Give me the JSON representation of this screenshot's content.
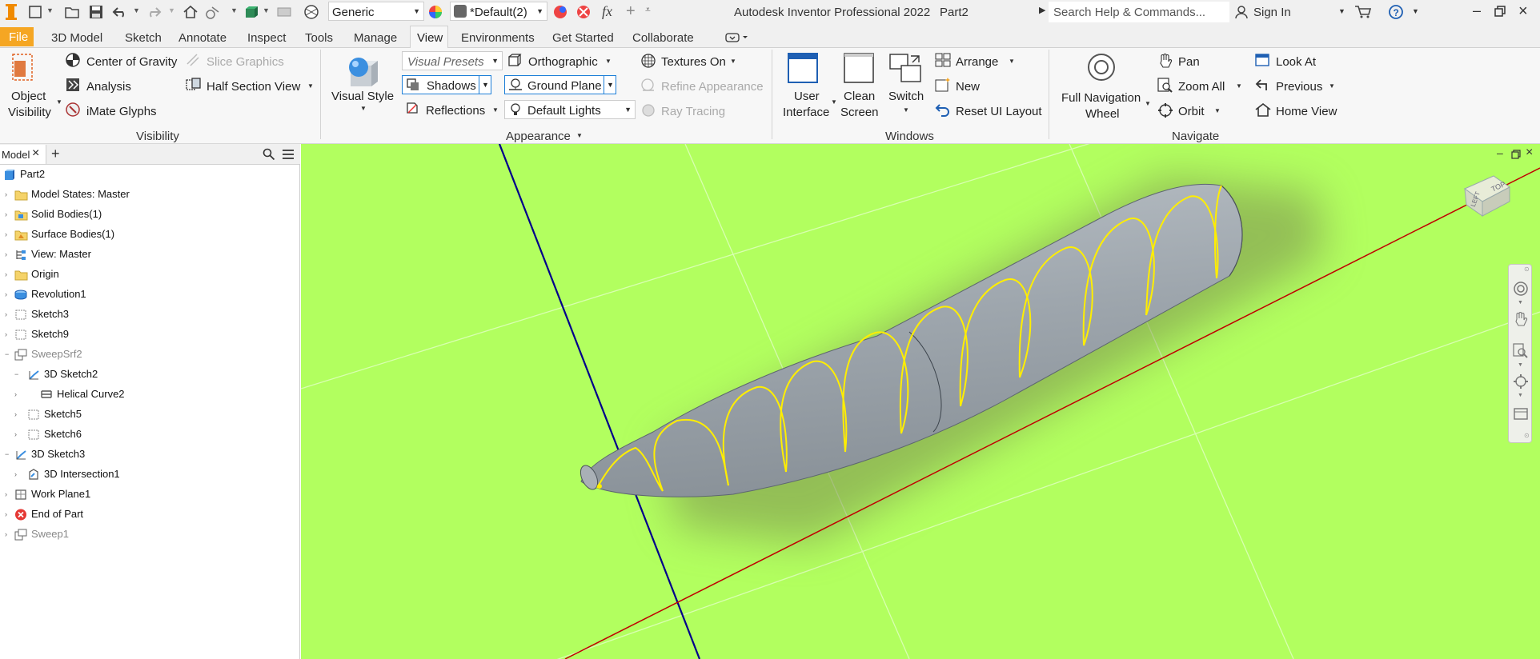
{
  "titlebar": {
    "app_title": "Autodesk Inventor Professional 2022",
    "doc_name": "Part2",
    "material_value": "Generic",
    "appearance_value": "*Default(2)",
    "fx_label": "fx",
    "search_placeholder": "Search Help & Commands...",
    "sign_in": "Sign In"
  },
  "tabs": [
    "File",
    "3D Model",
    "Sketch",
    "Annotate",
    "Inspect",
    "Tools",
    "Manage",
    "View",
    "Environments",
    "Get Started",
    "Collaborate"
  ],
  "active_tab": "View",
  "ribbon": {
    "visibility": {
      "object_visibility_line1": "Object",
      "object_visibility_line2": "Visibility",
      "center_of_gravity": "Center of Gravity",
      "analysis": "Analysis",
      "imate_glyphs": "iMate Glyphs",
      "slice_graphics": "Slice Graphics",
      "half_section_view": "Half Section View",
      "title": "Visibility"
    },
    "appearance": {
      "visual_style": "Visual Style",
      "visual_presets": "Visual Presets",
      "shadows": "Shadows",
      "reflections": "Reflections",
      "orthographic": "Orthographic",
      "ground_plane": "Ground Plane",
      "default_lights": "Default Lights",
      "textures_on": "Textures On",
      "refine_appearance": "Refine Appearance",
      "ray_tracing": "Ray Tracing",
      "title": "Appearance"
    },
    "windows": {
      "user_interface_line1": "User",
      "user_interface_line2": "Interface",
      "clean_screen_line1": "Clean",
      "clean_screen_line2": "Screen",
      "switch": "Switch",
      "arrange": "Arrange",
      "new": "New",
      "reset_ui_layout": "Reset UI Layout",
      "title": "Windows"
    },
    "navigate": {
      "full_nav_line1": "Full Navigation",
      "full_nav_line2": "Wheel",
      "pan": "Pan",
      "zoom_all": "Zoom All",
      "orbit": "Orbit",
      "look_at": "Look At",
      "previous": "Previous",
      "home_view": "Home View",
      "title": "Navigate"
    }
  },
  "browser": {
    "tab_label": "Model",
    "items": [
      {
        "label": "Part2",
        "indent": 0,
        "icon": "part-icon"
      },
      {
        "label": "Model States: Master",
        "indent": 1,
        "icon": "folder-icon"
      },
      {
        "label": "Solid Bodies(1)",
        "indent": 1,
        "icon": "solid-bodies-icon"
      },
      {
        "label": "Surface Bodies(1)",
        "indent": 1,
        "icon": "surface-bodies-icon"
      },
      {
        "label": "View: Master",
        "indent": 1,
        "icon": "view-icon"
      },
      {
        "label": "Origin",
        "indent": 1,
        "icon": "folder-icon"
      },
      {
        "label": "Revolution1",
        "indent": 1,
        "icon": "revolution-icon"
      },
      {
        "label": "Sketch3",
        "indent": 1,
        "icon": "sketch-icon"
      },
      {
        "label": "Sketch9",
        "indent": 1,
        "icon": "sketch-icon"
      },
      {
        "label": "SweepSrf2",
        "indent": 1,
        "icon": "sweep-icon"
      },
      {
        "label": "3D Sketch2",
        "indent": 2,
        "icon": "sketch3d-icon"
      },
      {
        "label": "Helical Curve2",
        "indent": 3,
        "icon": "helix-icon"
      },
      {
        "label": "Sketch5",
        "indent": 2,
        "icon": "sketch-icon"
      },
      {
        "label": "Sketch6",
        "indent": 2,
        "icon": "sketch-icon"
      },
      {
        "label": "3D Sketch3",
        "indent": 1,
        "icon": "sketch3d-icon"
      },
      {
        "label": "3D Intersection1",
        "indent": 2,
        "icon": "intersection-icon"
      },
      {
        "label": "Work Plane1",
        "indent": 1,
        "icon": "workplane-icon"
      },
      {
        "label": "End of Part",
        "indent": 1,
        "icon": "end-of-part-icon"
      },
      {
        "label": "Sweep1",
        "indent": 1,
        "icon": "sweep-icon"
      }
    ]
  },
  "viewcube": {
    "top_label": "TOP",
    "left_label": "LEFT"
  },
  "colors": {
    "ground": "#b2ff5f",
    "body": "#9aa2a8",
    "helix": "#ffee00",
    "x_axis": "#c00000",
    "z_axis": "#00008b",
    "accent_file": "#f5a623"
  }
}
